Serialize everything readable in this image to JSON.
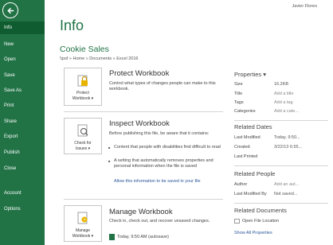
{
  "sidebar": {
    "items": [
      {
        "label": "Info",
        "active": true
      },
      {
        "label": "New"
      },
      {
        "label": "Open"
      },
      {
        "label": "Save"
      },
      {
        "label": "Save As"
      },
      {
        "label": "Print"
      },
      {
        "label": "Share"
      },
      {
        "label": "Export"
      },
      {
        "label": "Publish"
      },
      {
        "label": "Close"
      },
      {
        "label": "Account"
      },
      {
        "label": "Options"
      }
    ]
  },
  "header": {
    "user": "Javier Flores"
  },
  "main": {
    "title": "Info",
    "doc_title": "Cookie Sales",
    "path": "\\\\psf » Home » Documents » Excel 2016",
    "protect": {
      "btn_l1": "Protect",
      "btn_l2": "Workbook ▾",
      "title": "Protect Workbook",
      "text": "Control what types of changes people can make to this workbook."
    },
    "inspect": {
      "btn_l1": "Check for",
      "btn_l2": "Issues ▾",
      "title": "Inspect Workbook",
      "text": "Before publishing this file, be aware that it contains:",
      "b1": "Content that people with disabilities find difficult to read",
      "b2": "A setting that automatically removes properties and personal information when the file is saved",
      "link": "Allow this information to be saved in your file"
    },
    "manage": {
      "btn_l1": "Manage",
      "btn_l2": "Workbook ▾",
      "title": "Manage Workbook",
      "text": "Check in, check out, and recover unsaved changes.",
      "mod": "Today, 9:50 AM (autosave)"
    }
  },
  "properties": {
    "heading": "Properties ▾",
    "rows": [
      {
        "k": "Size",
        "v": "16.2KB"
      },
      {
        "k": "Title",
        "v": "Add a title"
      },
      {
        "k": "Tags",
        "v": "Add a tag"
      },
      {
        "k": "Categories",
        "v": "Add a cate..."
      }
    ],
    "dates_heading": "Related Dates",
    "dates": [
      {
        "k": "Last Modified",
        "v": "Today, 9:50..."
      },
      {
        "k": "Created",
        "v": "3/22/13 6:55..."
      },
      {
        "k": "Last Printed",
        "v": ""
      }
    ],
    "people_heading": "Related People",
    "people": [
      {
        "k": "Author",
        "v": "Add an aut..."
      },
      {
        "k": "Last Modified By",
        "v": "Not saved..."
      }
    ],
    "docs_heading": "Related Documents",
    "open_loc": "Open File Location",
    "show_all": "Show All Properties"
  },
  "colors": {
    "brand": "#217346",
    "active": "#0e5c2f",
    "link": "#2b579a"
  },
  "icons": [
    "back-arrow-icon",
    "lock-key-icon",
    "inspect-doc-icon",
    "manage-doc-icon",
    "excel-file-icon",
    "folder-icon"
  ]
}
